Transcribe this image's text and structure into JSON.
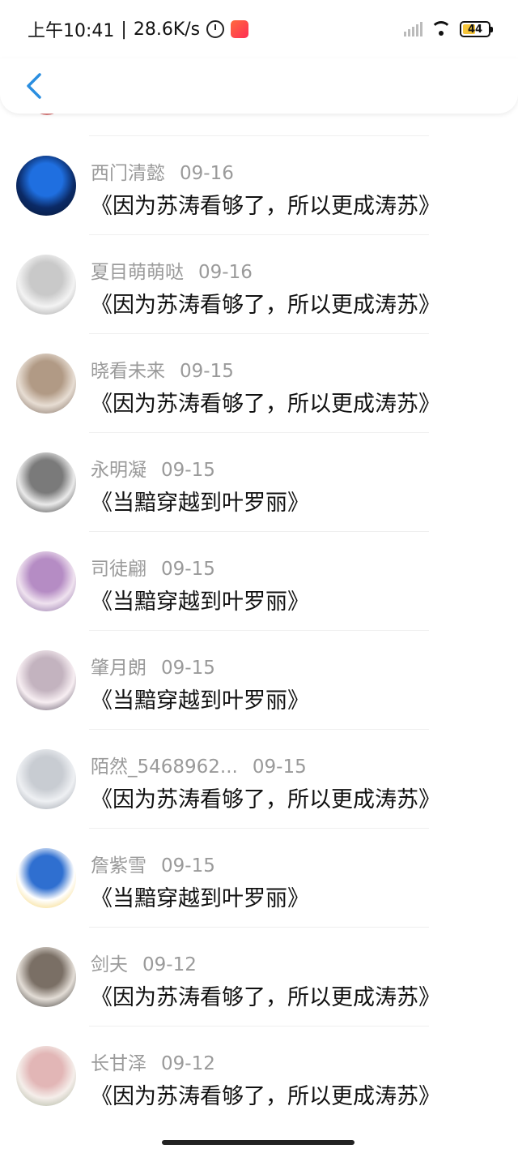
{
  "status": {
    "time": "上午10:41",
    "separator": "|",
    "speed": "28.6K/s",
    "battery": "44"
  },
  "items": [
    {
      "name": "西门清懿",
      "date": "09-16",
      "title": "《因为苏涛看够了，所以更成涛苏》",
      "avatar_colors": [
        "#0b2a66",
        "#1f6fe0",
        "#06152f"
      ]
    },
    {
      "name": "夏目萌萌哒",
      "date": "09-16",
      "title": "《因为苏涛看够了，所以更成涛苏》",
      "avatar_colors": [
        "#f3f3f3",
        "#c9c9c9",
        "#8f8f8f"
      ]
    },
    {
      "name": "晓看未来",
      "date": "09-15",
      "title": "《因为苏涛看够了，所以更成涛苏》",
      "avatar_colors": [
        "#e7ddd3",
        "#b19a85",
        "#6a5648"
      ]
    },
    {
      "name": "永明凝",
      "date": "09-15",
      "title": "《当黯穿越到叶罗丽》",
      "avatar_colors": [
        "#eaeaea",
        "#7a7a7a",
        "#151515"
      ]
    },
    {
      "name": "司徒翩",
      "date": "09-15",
      "title": "《当黯穿越到叶罗丽》",
      "avatar_colors": [
        "#efe2ef",
        "#b58cc4",
        "#7b5a96"
      ]
    },
    {
      "name": "肇月朗",
      "date": "09-15",
      "title": "《当黯穿越到叶罗丽》",
      "avatar_colors": [
        "#f7eef2",
        "#c3b3bf",
        "#3a2f44"
      ]
    },
    {
      "name": "陌然_5468962...",
      "date": "09-15",
      "title": "《因为苏涛看够了，所以更成涛苏》",
      "avatar_colors": [
        "#eef0f3",
        "#c8ccd2",
        "#8d939c"
      ]
    },
    {
      "name": "詹紫雪",
      "date": "09-15",
      "title": "《当黯穿越到叶罗丽》",
      "avatar_colors": [
        "#ffffff",
        "#2f6fd0",
        "#f2c84b"
      ]
    },
    {
      "name": "剑夫",
      "date": "09-12",
      "title": "《因为苏涛看够了，所以更成涛苏》",
      "avatar_colors": [
        "#e3ddd6",
        "#7a6f65",
        "#1a1816"
      ]
    },
    {
      "name": "长甘泽",
      "date": "09-12",
      "title": "《因为苏涛看够了，所以更成涛苏》",
      "avatar_colors": [
        "#f5eeea",
        "#e2b6b6",
        "#9aa68c"
      ]
    }
  ]
}
